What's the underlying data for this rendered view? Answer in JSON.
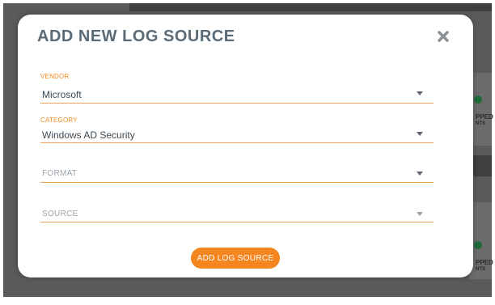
{
  "modal": {
    "title": "ADD NEW LOG SOURCE",
    "close_icon": "close-icon",
    "submit_label": "ADD LOG SOURCE"
  },
  "fields": {
    "vendor": {
      "label": "VENDOR",
      "value": "Microsoft"
    },
    "category": {
      "label": "CATEGORY",
      "value": "Windows AD Security"
    },
    "format": {
      "placeholder": "FORMAT"
    },
    "source": {
      "placeholder": "SOURCE"
    }
  },
  "background": {
    "card1_line1": "PPED",
    "card1_line2": "NTS",
    "card2_line1": "PPED",
    "card2_line2": "NTS"
  },
  "colors": {
    "accent": "#f5861f",
    "label": "#f28a1c",
    "title": "#5a6b78",
    "underline": "#f2a35b"
  }
}
